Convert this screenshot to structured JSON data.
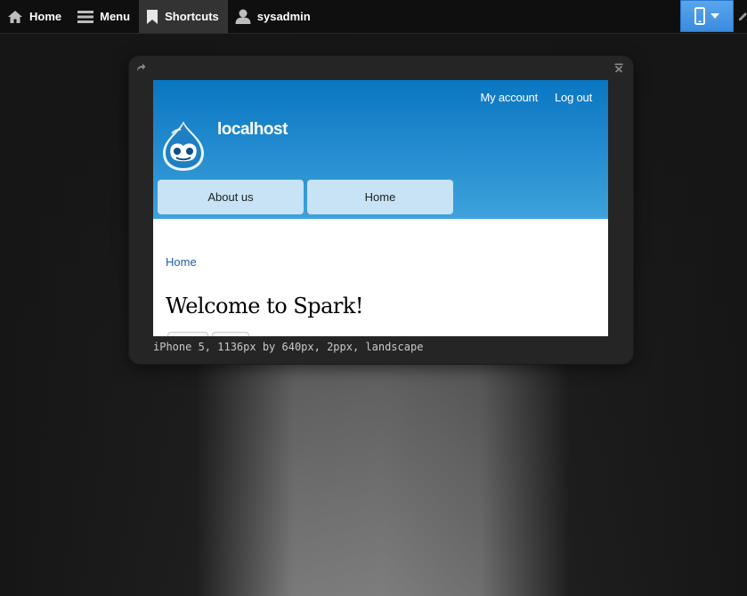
{
  "toolbar": {
    "items": [
      {
        "label": "Home",
        "icon": "home-icon"
      },
      {
        "label": "Menu",
        "icon": "menu-icon"
      },
      {
        "label": "Shortcuts",
        "icon": "bookmark-icon",
        "active": true
      },
      {
        "label": "sysadmin",
        "icon": "user-icon"
      }
    ],
    "device_button": {
      "icon": "phone-icon",
      "accent": "#4a99e8"
    }
  },
  "preview": {
    "caption": "iPhone 5, 1136px by 640px, 2ppx, landscape",
    "site": {
      "secondary_menu": [
        "My account",
        "Log out"
      ],
      "site_name": "localhost",
      "main_menu": [
        "About us",
        "Home"
      ],
      "breadcrumb": "Home",
      "page_title": "Welcome to Spark!",
      "header_color": "#1a86cf",
      "menu_tab_color": "#c7e3f5"
    }
  }
}
